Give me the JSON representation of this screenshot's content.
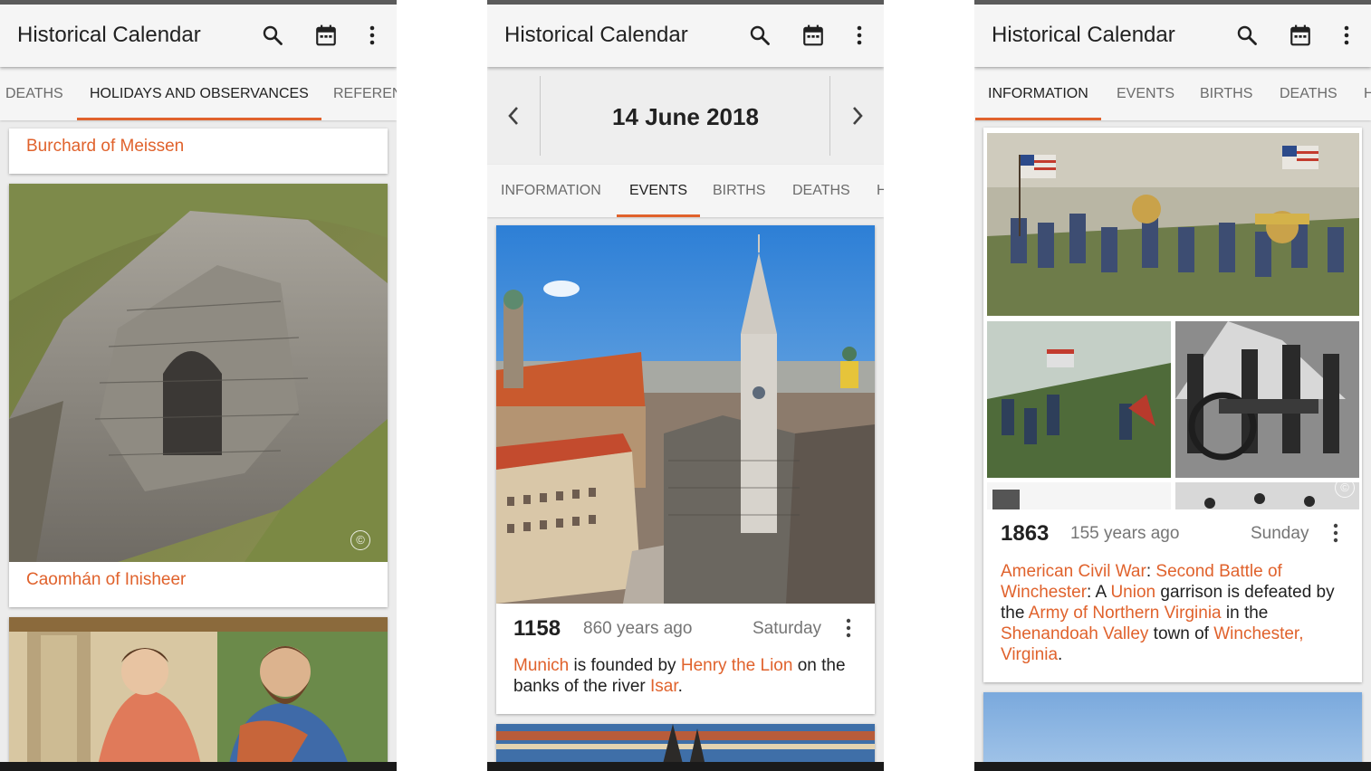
{
  "app": {
    "title": "Historical Calendar",
    "accent_color": "#e0622c",
    "icons": [
      "search-icon",
      "calendar-icon",
      "more-vert-icon"
    ]
  },
  "screen1": {
    "tabs": [
      {
        "label": "DEATHS",
        "active": false
      },
      {
        "label": "HOLIDAYS AND OBSERVANCES",
        "active": true
      },
      {
        "label": "REFERENCES",
        "active": false
      }
    ],
    "cards": [
      {
        "title": "Burchard of Meissen"
      },
      {
        "title": "Caomhán of Inisheer",
        "image": "stone ruin with arched doorway",
        "copyright": "©"
      },
      {
        "image": "painting of two figures"
      }
    ]
  },
  "screen2": {
    "date": "14 June 2018",
    "tabs": [
      {
        "label": "INFORMATION",
        "active": false
      },
      {
        "label": "EVENTS",
        "active": true
      },
      {
        "label": "BIRTHS",
        "active": false
      },
      {
        "label": "DEATHS",
        "active": false
      },
      {
        "label": "HOLIDAYS",
        "active": false
      }
    ],
    "event": {
      "year": "1158",
      "ago": "860 years ago",
      "weekday": "Saturday",
      "image": "aerial view of Munich city hall",
      "desc": {
        "link1": "Munich",
        "t1": " is founded by ",
        "link2": "Henry the Lion",
        "t2": " on the banks of the river ",
        "link3": "Isar",
        "t3": "."
      }
    }
  },
  "screen3": {
    "tabs": [
      {
        "label": "INFORMATION",
        "active": true
      },
      {
        "label": "EVENTS",
        "active": false
      },
      {
        "label": "BIRTHS",
        "active": false
      },
      {
        "label": "DEATHS",
        "active": false
      },
      {
        "label": "HOLIDAYS",
        "active": false
      }
    ],
    "event": {
      "year": "1863",
      "ago": "155 years ago",
      "weekday": "Sunday",
      "image": "Civil War battle collage",
      "copyright": "©",
      "desc": {
        "l1": "American Civil War",
        "t1": ": ",
        "l2": "Second Battle of Winchester",
        "t2": ": A ",
        "l3": "Union",
        "t3": " garrison is defeated by the ",
        "l4": "Army of Northern Virginia",
        "t4": " in the ",
        "l5": "Shenandoah Valley",
        "t5": " town of ",
        "l6": "Winchester, Virginia",
        "t6": "."
      }
    }
  }
}
